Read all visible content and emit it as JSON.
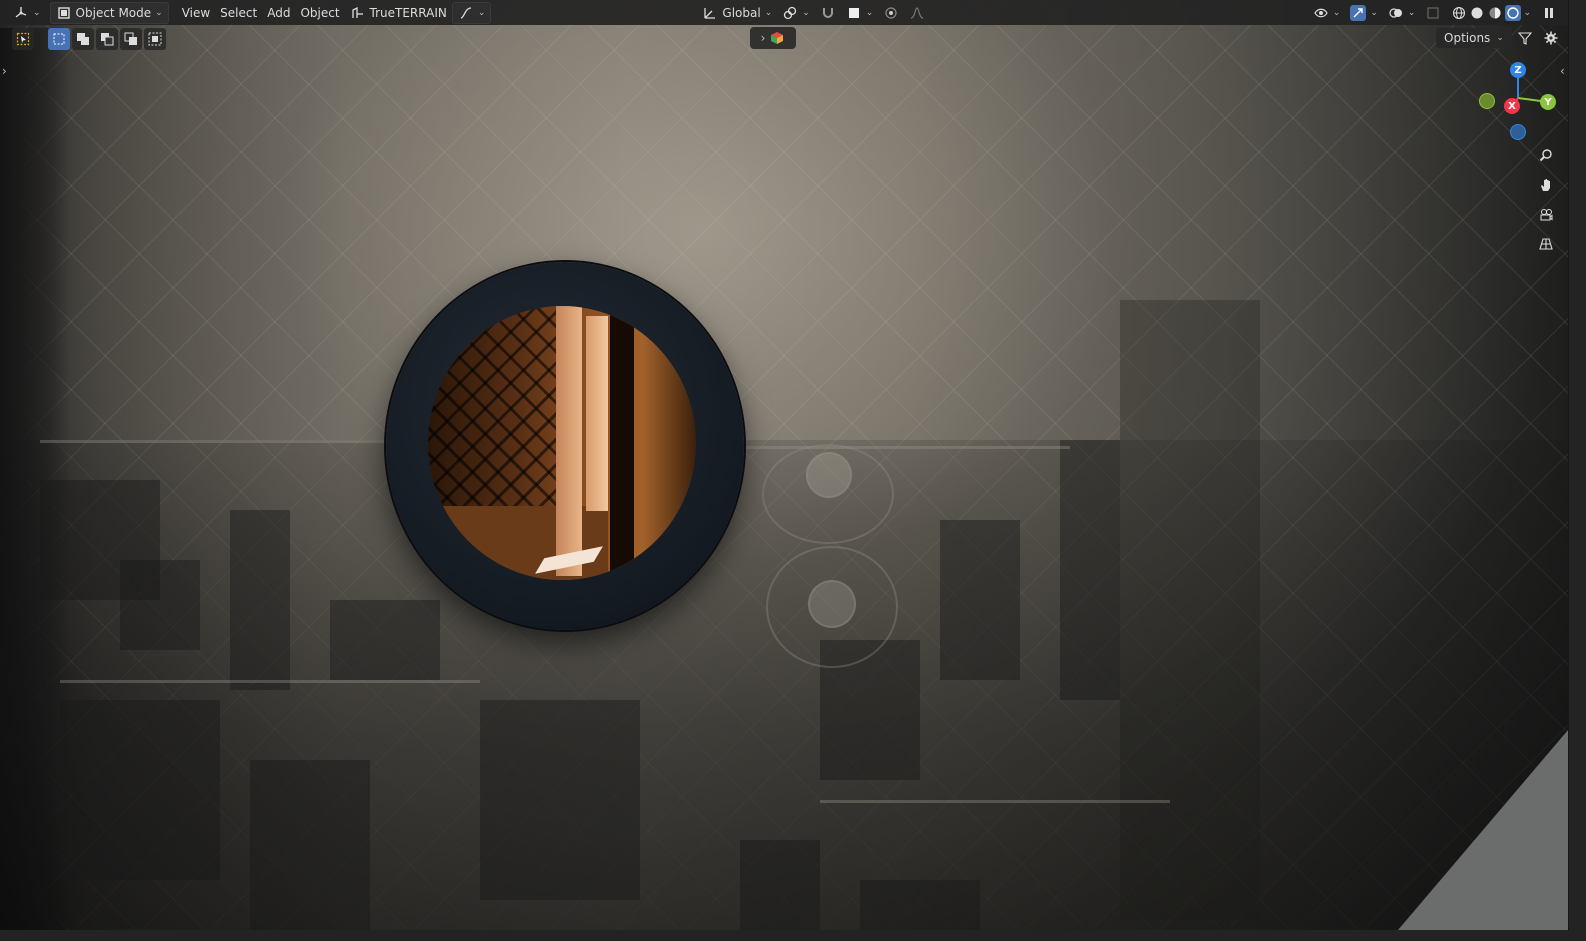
{
  "header": {
    "editor_type_icon": "3d-viewport-icon",
    "mode": {
      "label": "Object Mode",
      "icon": "object-mode-icon"
    },
    "menus": [
      "View",
      "Select",
      "Add",
      "Object"
    ],
    "addon": {
      "label": "TrueTERRAIN",
      "icon": "terrain-icon"
    },
    "transform_orientation": {
      "label": "Global",
      "icon": "orientation-icon"
    },
    "pivot_icon": "pivot-icon",
    "snap_icon": "magnet-icon",
    "proportional_icon": "proportional-edit-icon",
    "right_icons": [
      "visibility-icon",
      "gizmo-icon",
      "overlay-icon",
      "xray-icon",
      "wireframe-shading-icon",
      "solid-shading-icon",
      "material-shading-icon",
      "rendered-shading-icon",
      "pause-icon"
    ]
  },
  "tool_settings": {
    "select_modes": [
      "select-box-icon",
      "mode-new-icon",
      "mode-extend-icon",
      "mode-subtract-icon",
      "mode-intersect-icon"
    ]
  },
  "options_button": {
    "label": "Options"
  },
  "nav_gizmo": {
    "axes": {
      "x": "X",
      "y": "Y",
      "z": "Z"
    },
    "colors": {
      "x": "#f2374d",
      "y": "#8bc53f",
      "z": "#2e86e6",
      "neg_y": "#6a8a2e",
      "neg_z": "#2f5f96"
    }
  },
  "nav_tools": [
    "zoom-icon",
    "pan-hand-icon",
    "camera-view-icon",
    "grid-perspective-icon"
  ],
  "colors": {
    "accent": "#4772b3",
    "header_bg": "#232323"
  }
}
